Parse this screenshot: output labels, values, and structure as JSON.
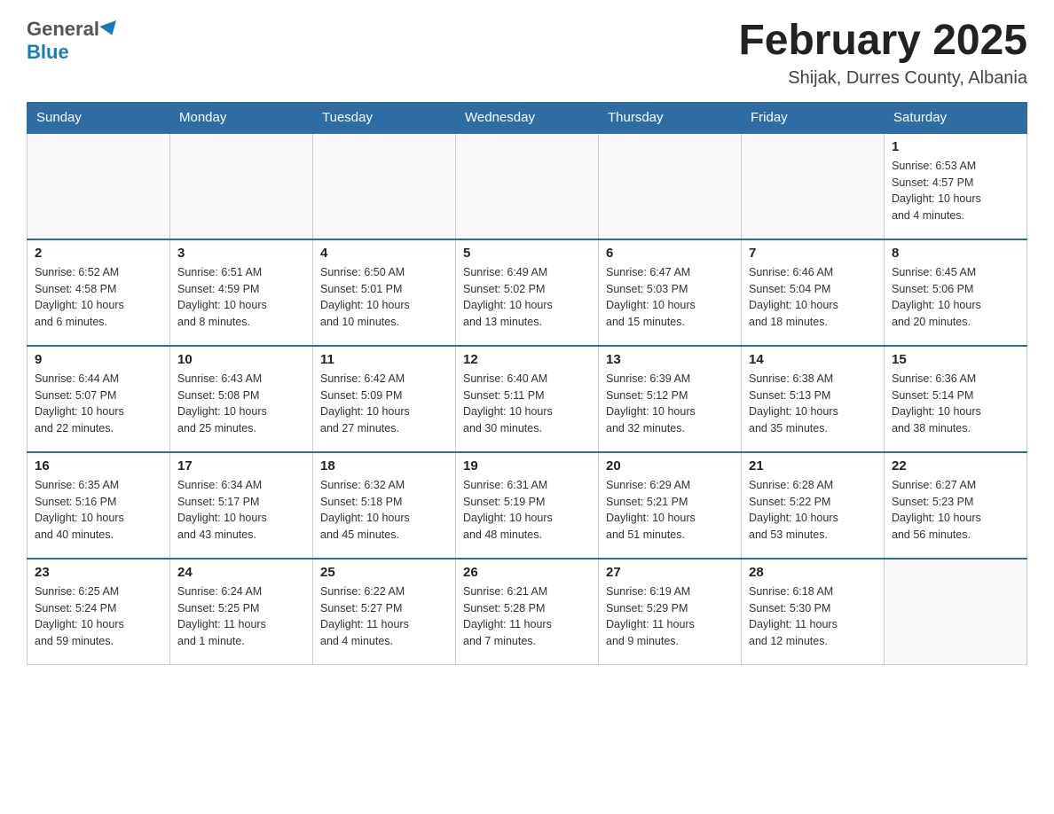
{
  "header": {
    "logo_general": "General",
    "logo_blue": "Blue",
    "month_title": "February 2025",
    "location": "Shijak, Durres County, Albania"
  },
  "weekdays": [
    "Sunday",
    "Monday",
    "Tuesday",
    "Wednesday",
    "Thursday",
    "Friday",
    "Saturday"
  ],
  "weeks": [
    {
      "days": [
        {
          "number": "",
          "info": ""
        },
        {
          "number": "",
          "info": ""
        },
        {
          "number": "",
          "info": ""
        },
        {
          "number": "",
          "info": ""
        },
        {
          "number": "",
          "info": ""
        },
        {
          "number": "",
          "info": ""
        },
        {
          "number": "1",
          "info": "Sunrise: 6:53 AM\nSunset: 4:57 PM\nDaylight: 10 hours\nand 4 minutes."
        }
      ]
    },
    {
      "days": [
        {
          "number": "2",
          "info": "Sunrise: 6:52 AM\nSunset: 4:58 PM\nDaylight: 10 hours\nand 6 minutes."
        },
        {
          "number": "3",
          "info": "Sunrise: 6:51 AM\nSunset: 4:59 PM\nDaylight: 10 hours\nand 8 minutes."
        },
        {
          "number": "4",
          "info": "Sunrise: 6:50 AM\nSunset: 5:01 PM\nDaylight: 10 hours\nand 10 minutes."
        },
        {
          "number": "5",
          "info": "Sunrise: 6:49 AM\nSunset: 5:02 PM\nDaylight: 10 hours\nand 13 minutes."
        },
        {
          "number": "6",
          "info": "Sunrise: 6:47 AM\nSunset: 5:03 PM\nDaylight: 10 hours\nand 15 minutes."
        },
        {
          "number": "7",
          "info": "Sunrise: 6:46 AM\nSunset: 5:04 PM\nDaylight: 10 hours\nand 18 minutes."
        },
        {
          "number": "8",
          "info": "Sunrise: 6:45 AM\nSunset: 5:06 PM\nDaylight: 10 hours\nand 20 minutes."
        }
      ]
    },
    {
      "days": [
        {
          "number": "9",
          "info": "Sunrise: 6:44 AM\nSunset: 5:07 PM\nDaylight: 10 hours\nand 22 minutes."
        },
        {
          "number": "10",
          "info": "Sunrise: 6:43 AM\nSunset: 5:08 PM\nDaylight: 10 hours\nand 25 minutes."
        },
        {
          "number": "11",
          "info": "Sunrise: 6:42 AM\nSunset: 5:09 PM\nDaylight: 10 hours\nand 27 minutes."
        },
        {
          "number": "12",
          "info": "Sunrise: 6:40 AM\nSunset: 5:11 PM\nDaylight: 10 hours\nand 30 minutes."
        },
        {
          "number": "13",
          "info": "Sunrise: 6:39 AM\nSunset: 5:12 PM\nDaylight: 10 hours\nand 32 minutes."
        },
        {
          "number": "14",
          "info": "Sunrise: 6:38 AM\nSunset: 5:13 PM\nDaylight: 10 hours\nand 35 minutes."
        },
        {
          "number": "15",
          "info": "Sunrise: 6:36 AM\nSunset: 5:14 PM\nDaylight: 10 hours\nand 38 minutes."
        }
      ]
    },
    {
      "days": [
        {
          "number": "16",
          "info": "Sunrise: 6:35 AM\nSunset: 5:16 PM\nDaylight: 10 hours\nand 40 minutes."
        },
        {
          "number": "17",
          "info": "Sunrise: 6:34 AM\nSunset: 5:17 PM\nDaylight: 10 hours\nand 43 minutes."
        },
        {
          "number": "18",
          "info": "Sunrise: 6:32 AM\nSunset: 5:18 PM\nDaylight: 10 hours\nand 45 minutes."
        },
        {
          "number": "19",
          "info": "Sunrise: 6:31 AM\nSunset: 5:19 PM\nDaylight: 10 hours\nand 48 minutes."
        },
        {
          "number": "20",
          "info": "Sunrise: 6:29 AM\nSunset: 5:21 PM\nDaylight: 10 hours\nand 51 minutes."
        },
        {
          "number": "21",
          "info": "Sunrise: 6:28 AM\nSunset: 5:22 PM\nDaylight: 10 hours\nand 53 minutes."
        },
        {
          "number": "22",
          "info": "Sunrise: 6:27 AM\nSunset: 5:23 PM\nDaylight: 10 hours\nand 56 minutes."
        }
      ]
    },
    {
      "days": [
        {
          "number": "23",
          "info": "Sunrise: 6:25 AM\nSunset: 5:24 PM\nDaylight: 10 hours\nand 59 minutes."
        },
        {
          "number": "24",
          "info": "Sunrise: 6:24 AM\nSunset: 5:25 PM\nDaylight: 11 hours\nand 1 minute."
        },
        {
          "number": "25",
          "info": "Sunrise: 6:22 AM\nSunset: 5:27 PM\nDaylight: 11 hours\nand 4 minutes."
        },
        {
          "number": "26",
          "info": "Sunrise: 6:21 AM\nSunset: 5:28 PM\nDaylight: 11 hours\nand 7 minutes."
        },
        {
          "number": "27",
          "info": "Sunrise: 6:19 AM\nSunset: 5:29 PM\nDaylight: 11 hours\nand 9 minutes."
        },
        {
          "number": "28",
          "info": "Sunrise: 6:18 AM\nSunset: 5:30 PM\nDaylight: 11 hours\nand 12 minutes."
        },
        {
          "number": "",
          "info": ""
        }
      ]
    }
  ]
}
